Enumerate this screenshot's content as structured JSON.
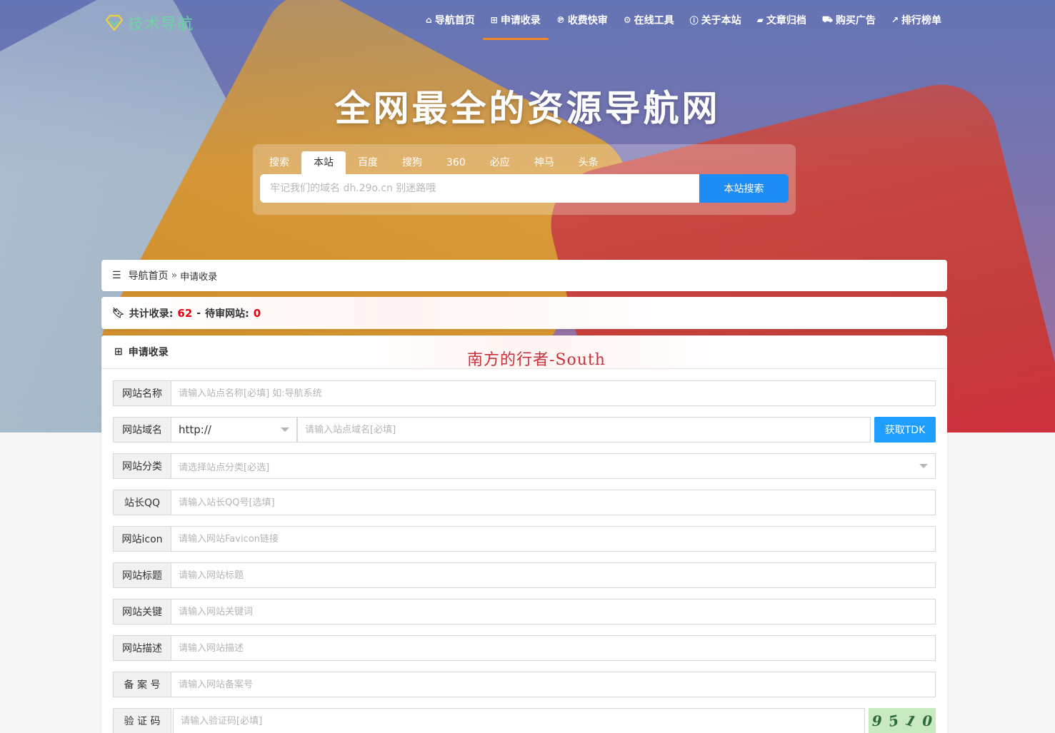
{
  "brand": {
    "name": "技术导航",
    "accent": "#6fd3a6"
  },
  "nav": {
    "items": [
      {
        "label": "导航首页",
        "icon": "home-icon",
        "glyph": "⌂"
      },
      {
        "label": "申请收录",
        "icon": "plus-square-icon",
        "glyph": "⊞",
        "active": true
      },
      {
        "label": "收费快审",
        "icon": "paypal-icon",
        "glyph": "℗"
      },
      {
        "label": "在线工具",
        "icon": "gears-icon",
        "glyph": "⚙"
      },
      {
        "label": "关于本站",
        "icon": "info-circle-icon",
        "glyph": "ⓘ"
      },
      {
        "label": "文章归档",
        "icon": "folder-open-icon",
        "glyph": "▰"
      },
      {
        "label": "购买广告",
        "icon": "shopping-cart-icon",
        "glyph": "⛟"
      },
      {
        "label": "排行榜单",
        "icon": "line-chart-icon",
        "glyph": "↗"
      }
    ],
    "active_color": "#f08a24"
  },
  "hero": {
    "headline": "全网最全的资源导航网"
  },
  "search": {
    "tabs": [
      "搜索",
      "本站",
      "百度",
      "搜狗",
      "360",
      "必应",
      "神马",
      "头条"
    ],
    "active_tab": "本站",
    "placeholder": "牢记我们的域名 dh.29o.cn 别迷路哦",
    "button": "本站搜索",
    "button_color": "#1e8cf5"
  },
  "breadcrumb": {
    "home": "导航首页",
    "separator": "»",
    "current": "申请收录"
  },
  "stats": {
    "total_label": "共计收录:",
    "total": "62",
    "dash": "-",
    "pending_label": "待审网站:",
    "pending": "0"
  },
  "form": {
    "title": "申请收录",
    "watermark": "南方的行者-South",
    "fields": {
      "name": {
        "label": "网站名称",
        "placeholder": "请输入站点名称[必填] 如:导航系统"
      },
      "domain": {
        "label": "网站域名",
        "protocol": "http://",
        "placeholder": "请输入站点域名[必填]",
        "button": "获取TDK"
      },
      "category": {
        "label": "网站分类",
        "placeholder": "请选择站点分类[必选]"
      },
      "qq": {
        "label": "站长QQ",
        "placeholder": "请输入站长QQ号[选填]"
      },
      "icon": {
        "label": "网站icon",
        "placeholder": "请输入网站Favicon链接"
      },
      "title": {
        "label": "网站标题",
        "placeholder": "请输入网站标题"
      },
      "keywords": {
        "label": "网站关键",
        "placeholder": "请输入网站关键词"
      },
      "description": {
        "label": "网站描述",
        "placeholder": "请输入网站描述"
      },
      "icp": {
        "label": "备 案 号",
        "placeholder": "请输入网站备案号"
      },
      "captcha": {
        "label": "验 证 码",
        "placeholder": "请输入验证码[必填]",
        "code": [
          "9",
          "5",
          "1",
          "0"
        ]
      }
    }
  }
}
